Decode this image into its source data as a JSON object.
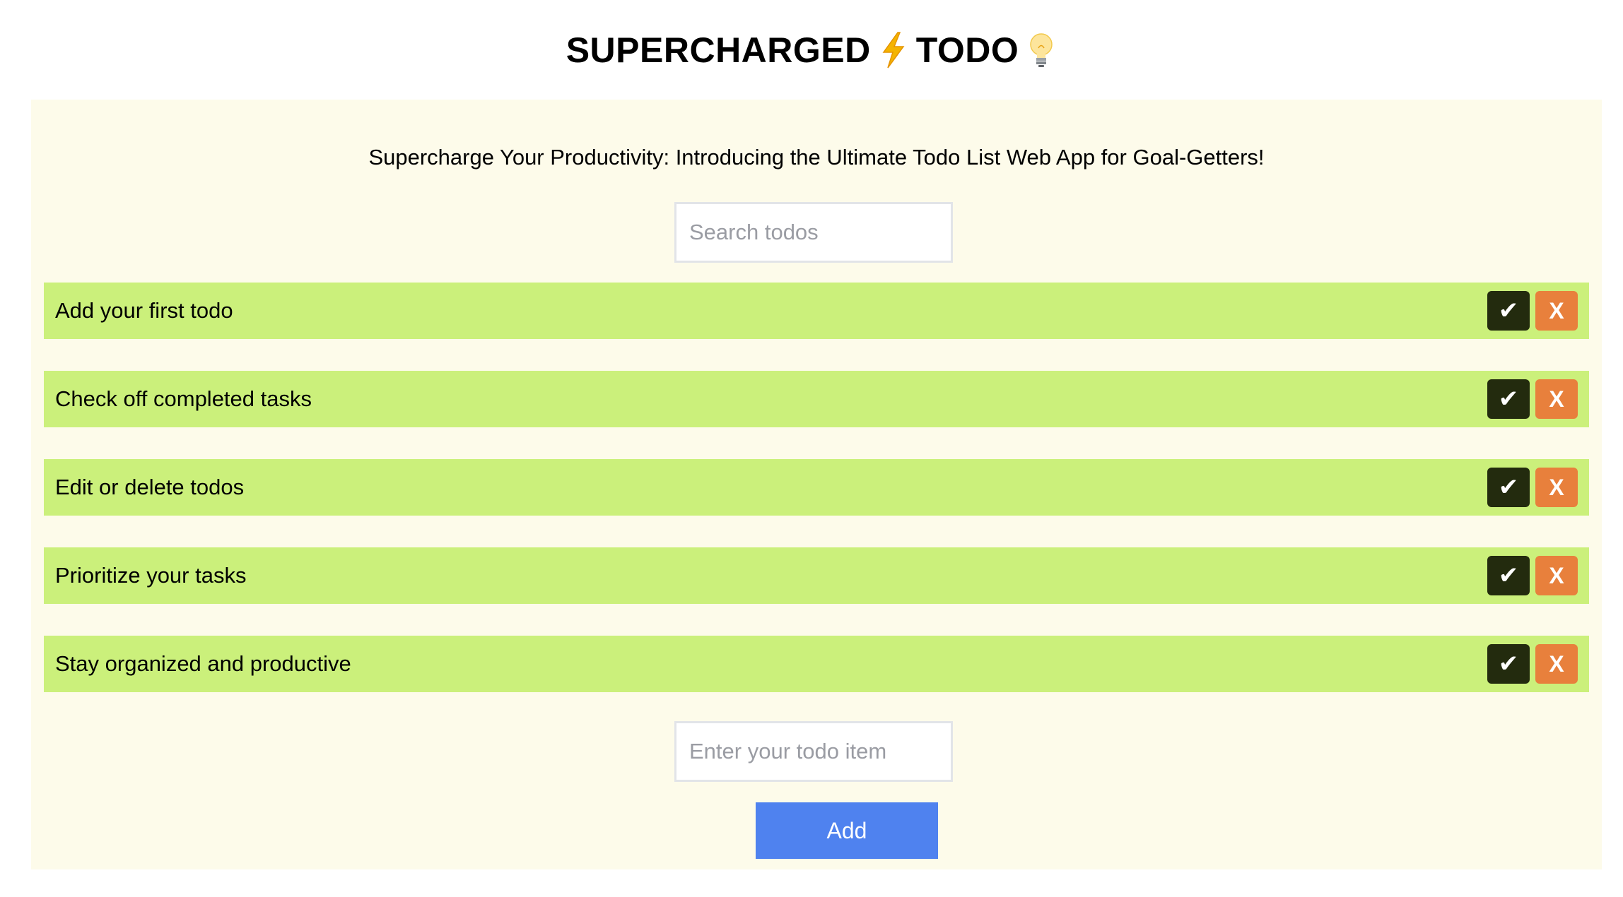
{
  "header": {
    "title_part1": "SUPERCHARGED",
    "title_part2": "TODO",
    "lightning_icon": "lightning-bolt-emoji",
    "bulb_icon": "light-bulb-emoji"
  },
  "main": {
    "tagline": "Supercharge Your Productivity: Introducing the Ultimate Todo List Web App for Goal-Getters!",
    "search": {
      "placeholder": "Search todos",
      "value": ""
    },
    "todos": [
      {
        "text": "Add your first todo",
        "complete_label": "✔",
        "delete_label": "X"
      },
      {
        "text": "Check off completed tasks",
        "complete_label": "✔",
        "delete_label": "X"
      },
      {
        "text": "Edit or delete todos",
        "complete_label": "✔",
        "delete_label": "X"
      },
      {
        "text": "Prioritize your tasks",
        "complete_label": "✔",
        "delete_label": "X"
      },
      {
        "text": "Stay organized and productive",
        "complete_label": "✔",
        "delete_label": "X"
      }
    ],
    "new_todo": {
      "placeholder": "Enter your todo item",
      "value": ""
    },
    "add_label": "Add"
  },
  "colors": {
    "panel_background": "#fdfbea",
    "todo_background": "#cbf07b",
    "complete_button": "#232b0e",
    "delete_button": "#e8803c",
    "add_button": "#4f82ef"
  }
}
